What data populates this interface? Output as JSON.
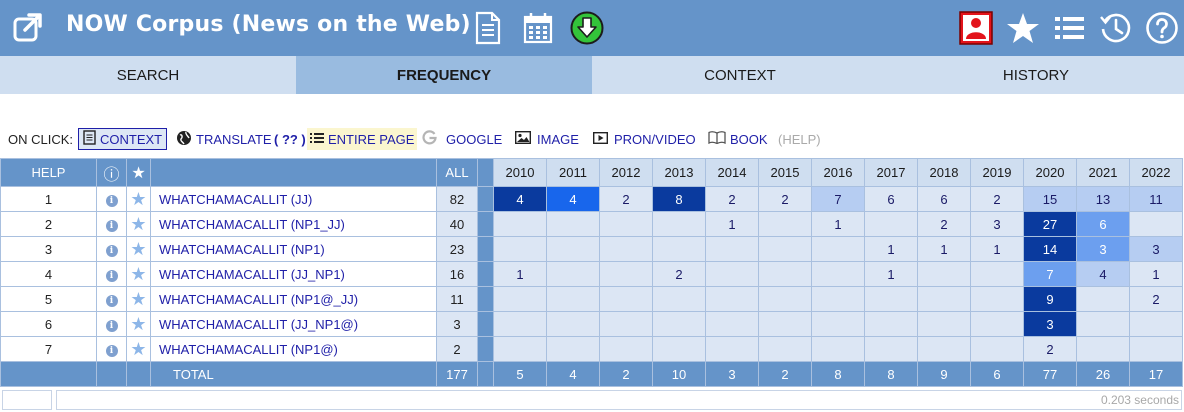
{
  "header": {
    "title": "NOW Corpus (News on the Web)",
    "icons": [
      "external-link-icon",
      "document-icon",
      "calendar-icon",
      "download-icon",
      "user-icon",
      "star-icon",
      "list-icon",
      "history-icon",
      "help-icon"
    ]
  },
  "tabs": [
    {
      "label": "SEARCH",
      "active": false
    },
    {
      "label": "FREQUENCY",
      "active": true
    },
    {
      "label": "CONTEXT",
      "active": false
    },
    {
      "label": "HISTORY",
      "active": false
    }
  ],
  "onclick": {
    "label": "ON CLICK:",
    "context": "CONTEXT",
    "translate": "TRANSLATE",
    "translate_q": "( ?? )",
    "entire_page": "ENTIRE PAGE",
    "google": "GOOGLE",
    "image": "IMAGE",
    "pron_video": "PRON/VIDEO",
    "book": "BOOK",
    "help": "(HELP)"
  },
  "table": {
    "col_help": "HELP",
    "col_info": "ⓘ",
    "col_star": "★",
    "col_all": "ALL",
    "years": [
      "2010",
      "2011",
      "2012",
      "2013",
      "2014",
      "2015",
      "2016",
      "2017",
      "2018",
      "2019",
      "2020",
      "2021",
      "2022"
    ],
    "rows": [
      {
        "n": "1",
        "word": "WHATCHAMACALLIT (JJ)",
        "all": "82",
        "vals": [
          "4",
          "4",
          "2",
          "8",
          "2",
          "2",
          "7",
          "6",
          "6",
          "2",
          "15",
          "13",
          "11"
        ],
        "lv": [
          4,
          3,
          0,
          4,
          0,
          0,
          1,
          0,
          0,
          0,
          1,
          1,
          1
        ]
      },
      {
        "n": "2",
        "word": "WHATCHAMACALLIT (NP1_JJ)",
        "all": "40",
        "vals": [
          "",
          "",
          "",
          "",
          "1",
          "",
          "1",
          "",
          "2",
          "3",
          "27",
          "6",
          ""
        ],
        "lv": [
          0,
          0,
          0,
          0,
          0,
          0,
          0,
          0,
          0,
          0,
          4,
          2,
          0
        ]
      },
      {
        "n": "3",
        "word": "WHATCHAMACALLIT (NP1)",
        "all": "23",
        "vals": [
          "",
          "",
          "",
          "",
          "",
          "",
          "",
          "1",
          "1",
          "1",
          "14",
          "3",
          "3"
        ],
        "lv": [
          0,
          0,
          0,
          0,
          0,
          0,
          0,
          0,
          0,
          0,
          4,
          2,
          1
        ]
      },
      {
        "n": "4",
        "word": "WHATCHAMACALLIT (JJ_NP1)",
        "all": "16",
        "vals": [
          "1",
          "",
          "",
          "2",
          "",
          "",
          "",
          "1",
          "",
          "",
          "7",
          "4",
          "1"
        ],
        "lv": [
          0,
          0,
          0,
          0,
          0,
          0,
          0,
          0,
          0,
          0,
          2,
          1,
          0
        ]
      },
      {
        "n": "5",
        "word": "WHATCHAMACALLIT (NP1@_JJ)",
        "all": "11",
        "vals": [
          "",
          "",
          "",
          "",
          "",
          "",
          "",
          "",
          "",
          "",
          "9",
          "",
          "2"
        ],
        "lv": [
          0,
          0,
          0,
          0,
          0,
          0,
          0,
          0,
          0,
          0,
          4,
          0,
          0
        ]
      },
      {
        "n": "6",
        "word": "WHATCHAMACALLIT (JJ_NP1@)",
        "all": "3",
        "vals": [
          "",
          "",
          "",
          "",
          "",
          "",
          "",
          "",
          "",
          "",
          "3",
          "",
          ""
        ],
        "lv": [
          0,
          0,
          0,
          0,
          0,
          0,
          0,
          0,
          0,
          0,
          4,
          0,
          0
        ]
      },
      {
        "n": "7",
        "word": "WHATCHAMACALLIT (NP1@)",
        "all": "2",
        "vals": [
          "",
          "",
          "",
          "",
          "",
          "",
          "",
          "",
          "",
          "",
          "2",
          "",
          ""
        ],
        "lv": [
          0,
          0,
          0,
          0,
          0,
          0,
          0,
          0,
          0,
          0,
          0,
          0,
          0
        ]
      }
    ],
    "total": {
      "label": "TOTAL",
      "all": "177",
      "vals": [
        "5",
        "4",
        "2",
        "10",
        "3",
        "2",
        "8",
        "8",
        "9",
        "6",
        "77",
        "26",
        "17"
      ]
    }
  },
  "footer": {
    "timing": "0.203 seconds"
  },
  "colors": {
    "header_bg": "#6594c9",
    "tab_bg": "#cfdef0",
    "tab_active_bg": "#99bbe0",
    "cell_base": "#dce6f4",
    "heat_1": "#b6cdf2",
    "heat_2": "#6c9fef",
    "heat_3": "#1866ec",
    "heat_4": "#0a3a9e",
    "link": "#1f1fa8",
    "user_icon_bg": "#e3141b",
    "download_icon_bg": "#33c43a"
  }
}
